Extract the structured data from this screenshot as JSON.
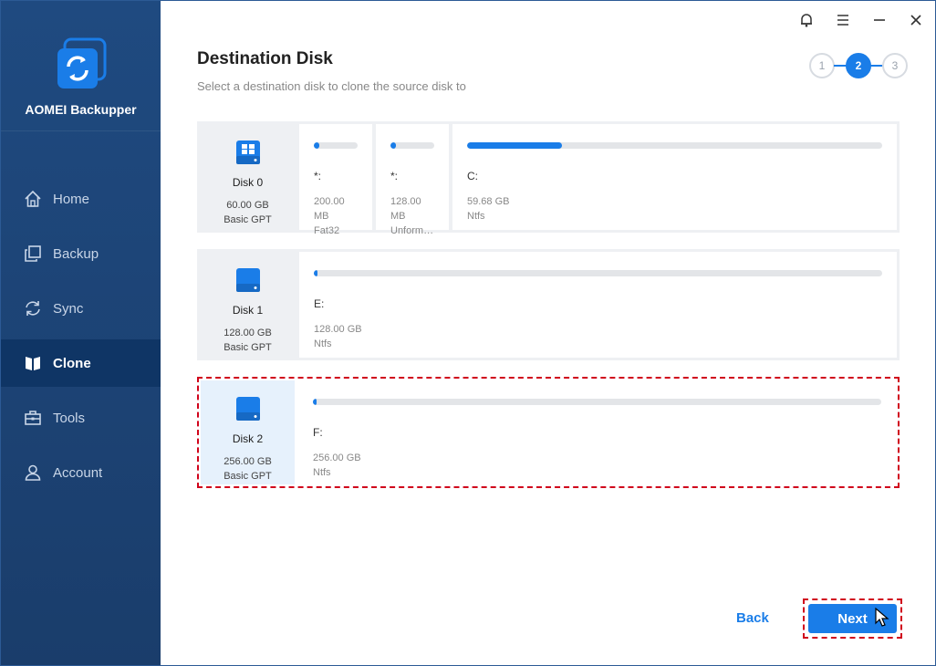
{
  "app": {
    "name": "AOMEI Backupper"
  },
  "nav": [
    {
      "label": "Home",
      "icon": "home-icon",
      "active": false
    },
    {
      "label": "Backup",
      "icon": "backup-icon",
      "active": false
    },
    {
      "label": "Sync",
      "icon": "sync-icon",
      "active": false
    },
    {
      "label": "Clone",
      "icon": "clone-icon",
      "active": true
    },
    {
      "label": "Tools",
      "icon": "tools-icon",
      "active": false
    },
    {
      "label": "Account",
      "icon": "account-icon",
      "active": false
    }
  ],
  "header": {
    "title": "Destination Disk",
    "subtitle": "Select a destination disk to clone the source disk to"
  },
  "stepper": {
    "steps": [
      "1",
      "2",
      "3"
    ],
    "current": 2
  },
  "disks": [
    {
      "name": "Disk 0",
      "size": "60.00 GB",
      "type": "Basic GPT",
      "selected": false,
      "partitions": [
        {
          "label": "*:",
          "size": "200.00 MB",
          "fs": "Fat32",
          "used_fraction": 0.05
        },
        {
          "label": "*:",
          "size": "128.00 MB",
          "fs": "Unformat...",
          "used_fraction": 0.05
        },
        {
          "label": "C:",
          "size": "59.68 GB",
          "fs": "Ntfs",
          "used_fraction": 0.23
        }
      ]
    },
    {
      "name": "Disk 1",
      "size": "128.00 GB",
      "type": "Basic GPT",
      "selected": false,
      "partitions": [
        {
          "label": "E:",
          "size": "128.00 GB",
          "fs": "Ntfs",
          "used_fraction": 0.005
        }
      ]
    },
    {
      "name": "Disk 2",
      "size": "256.00 GB",
      "type": "Basic GPT",
      "selected": true,
      "partitions": [
        {
          "label": "F:",
          "size": "256.00 GB",
          "fs": "Ntfs",
          "used_fraction": 0.005
        }
      ]
    }
  ],
  "footer": {
    "back_label": "Back",
    "next_label": "Next"
  },
  "colors": {
    "accent": "#1a7de8",
    "sidebar": "#1f4a80",
    "highlight": "#d0021b"
  }
}
